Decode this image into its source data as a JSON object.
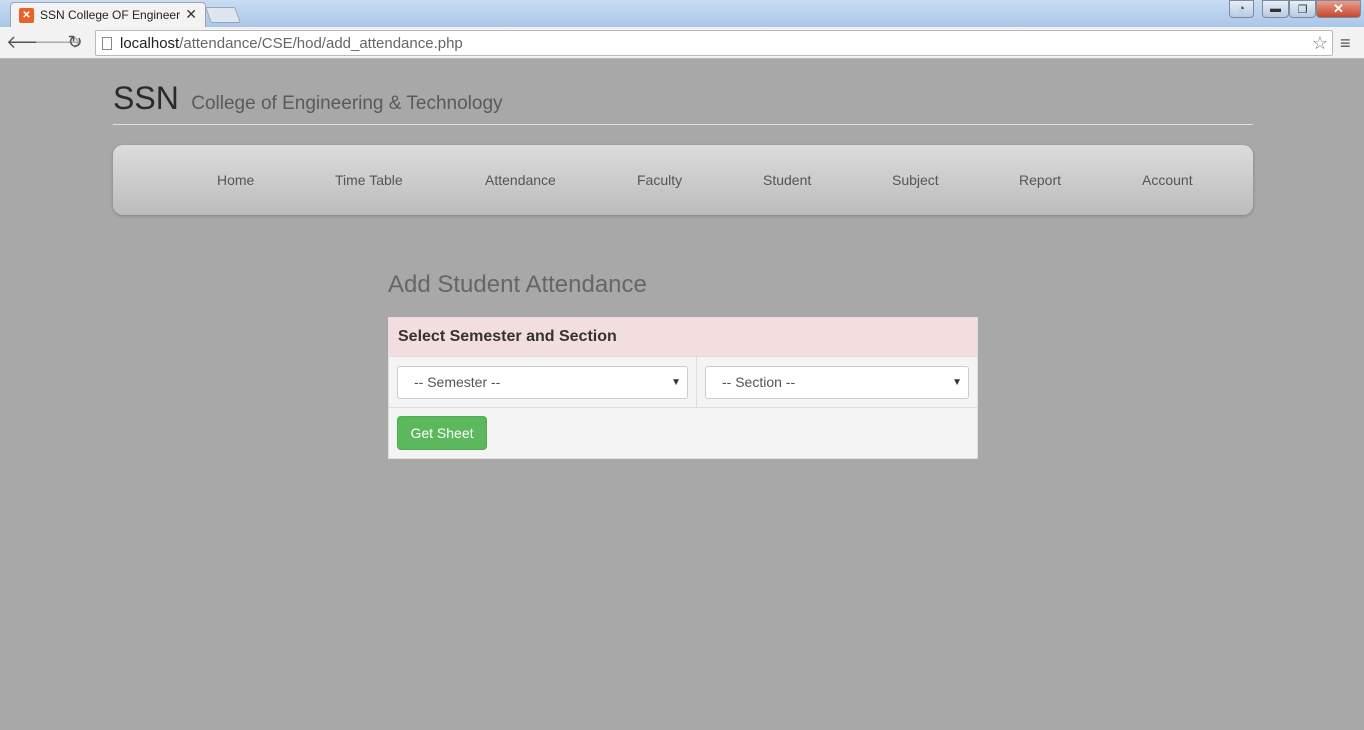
{
  "browser": {
    "tab_title": "SSN College OF Engineeri",
    "tab_favicon": "xampp-icon",
    "url_host": "localhost",
    "url_path": "/attendance/CSE/hod/add_attendance.php",
    "close_symbol": "✕",
    "win_close_symbol": "✕"
  },
  "brand": {
    "main": "SSN",
    "sub": "College of Engineering & Technology"
  },
  "nav": {
    "items": [
      "Home",
      "Time Table",
      "Attendance",
      "Faculty",
      "Student",
      "Subject",
      "Report",
      "Account"
    ]
  },
  "main": {
    "title": "Add Student Attendance",
    "panel_heading": "Select Semester and Section",
    "semester_select": "-- Semester --",
    "section_select": "-- Section --",
    "submit_label": "Get Sheet"
  },
  "colors": {
    "page_background": "#a8a8a8",
    "panel_heading": "#f2dede",
    "button": "#5cb85c"
  }
}
